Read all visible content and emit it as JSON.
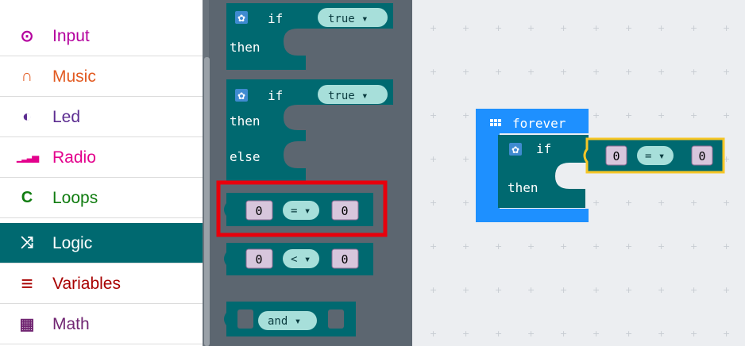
{
  "categories": [
    {
      "id": "input",
      "label": "Input",
      "icon": "⊙",
      "icon_name": "radio-target-icon",
      "color": "#b4009e"
    },
    {
      "id": "music",
      "label": "Music",
      "icon": "∩",
      "icon_name": "headphones-icon",
      "color": "#e25a21"
    },
    {
      "id": "led",
      "label": "Led",
      "icon": "◐",
      "icon_name": "toggle-icon",
      "color": "#5c2d91"
    },
    {
      "id": "radio",
      "label": "Radio",
      "icon": "▁▂▃▅",
      "icon_name": "signal-bars-icon",
      "color": "#e3008c"
    },
    {
      "id": "loops",
      "label": "Loops",
      "icon": "C",
      "icon_name": "loop-arrow-icon",
      "color": "#107c10"
    },
    {
      "id": "logic",
      "label": "Logic",
      "icon": "⤨",
      "icon_name": "shuffle-icon",
      "color": "#006970",
      "active": true
    },
    {
      "id": "variables",
      "label": "Variables",
      "icon": "≡",
      "icon_name": "variables-icon",
      "color": "#a80000"
    },
    {
      "id": "math",
      "label": "Math",
      "icon": "▦",
      "icon_name": "calculator-icon",
      "color": "#712672"
    }
  ],
  "flyout": {
    "if_kw": "if",
    "then_kw": "then",
    "else_kw": "else",
    "true_val": "true ▾",
    "eq_left": "0",
    "eq_op": "= ▾",
    "eq_right": "0",
    "lt_left": "0",
    "lt_op": "< ▾",
    "lt_right": "0",
    "and_op": "and ▾"
  },
  "workspace": {
    "forever_label": "forever",
    "if_kw": "if",
    "then_kw": "then",
    "eq_left": "0",
    "eq_op": "= ▾",
    "eq_right": "0",
    "colors": {
      "forever": "#1e90ff",
      "logic": "#006970",
      "highlight": "#f6c626"
    }
  },
  "highlight_color": "#e8000c"
}
